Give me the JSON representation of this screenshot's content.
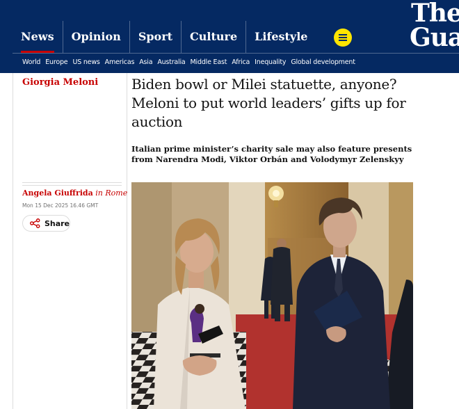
{
  "nav": {
    "pillars": [
      "News",
      "Opinion",
      "Sport",
      "Culture",
      "Lifestyle"
    ],
    "active": "News",
    "subnav": [
      "World",
      "Europe",
      "US news",
      "Americas",
      "Asia",
      "Australia",
      "Middle East",
      "Africa",
      "Inequality",
      "Global development"
    ],
    "logo": [
      "The",
      "Guardian"
    ]
  },
  "article": {
    "section": "Giorgia Meloni",
    "headline": "Biden bowl or Milei statuette, anyone? Meloni to put world leaders’ gifts up for auction",
    "standfirst": "Italian prime minister’s charity sale may also feature presents from Narendra Modi, Viktor Orbán and Volodymyr Zelenskyy",
    "author": "Angela Giuffrida",
    "location_prefix": "in",
    "location": "Rome",
    "date": "Mon 15 Dec 2025 16.46 GMT",
    "share_label": "Share"
  },
  "colors": {
    "brand_blue": "#052962",
    "news_red": "#c70000",
    "menu_yellow": "#ffe500"
  },
  "icons": [
    "menu-icon",
    "share-icon"
  ]
}
